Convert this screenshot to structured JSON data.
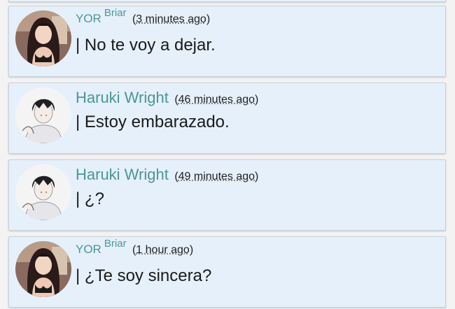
{
  "posts": [
    {
      "author_prefix": "YOR",
      "author_sup": "Briar",
      "author_name": "",
      "time_open": "(",
      "time_link": "3 minutes ago",
      "time_close": ")",
      "text": "| No te voy a dejar.",
      "avatar": "yor-avatar"
    },
    {
      "author_prefix": "",
      "author_sup": "",
      "author_name": "Haruki Wright",
      "time_open": "(",
      "time_link": "46 minutes ago",
      "time_close": ")",
      "text": "| Estoy embarazado.",
      "avatar": "haruki-avatar"
    },
    {
      "author_prefix": "",
      "author_sup": "",
      "author_name": "Haruki Wright",
      "time_open": "(",
      "time_link": "49 minutes ago",
      "time_close": ")",
      "text": "| ¿?",
      "avatar": "haruki-avatar"
    },
    {
      "author_prefix": "YOR",
      "author_sup": "Briar",
      "author_name": "",
      "time_open": "(",
      "time_link": "1 hour ago",
      "time_close": ")",
      "text": "| ¿Te soy sincera?",
      "avatar": "yor-avatar"
    }
  ],
  "colors": {
    "card_background": "#e5f0fb",
    "author_color": "#4a9696",
    "text_color": "#1a1a1a"
  }
}
